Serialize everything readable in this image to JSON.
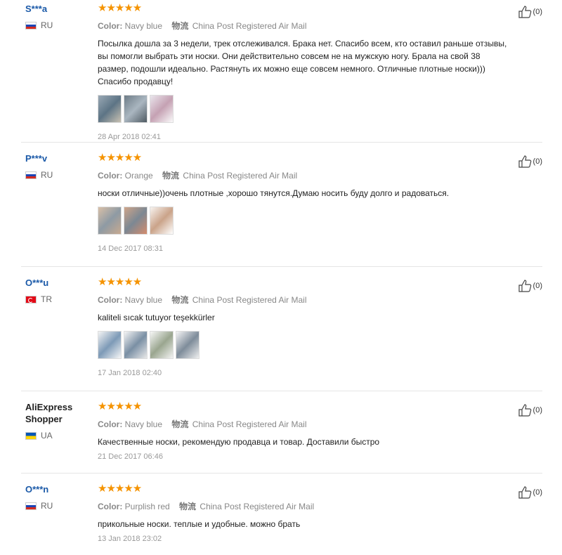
{
  "reviews": [
    {
      "user": "S***a",
      "country": "RU",
      "flag": "ru",
      "stars": "★★★★★",
      "color_label": "Color:",
      "color": "Navy blue",
      "ship_label": "物流",
      "shipping": "China Post Registered Air Mail",
      "text": "Посылка дошла за 3 недели, трек отслеживался. Брака нет. Спасибо всем, кто оставил раньше отзывы, вы помогли выбрать эти носки. Они действительно совсем не на мужскую ногу. Брала на свой 38 размер, подошли идеально. Растянуть их можно еще совсем немного. Отличные плотные носки))) Спасибо продавцу!",
      "date": "28 Apr 2018 02:41",
      "likes": "(0)"
    },
    {
      "user": "P***v",
      "country": "RU",
      "flag": "ru",
      "stars": "★★★★★",
      "color_label": "Color:",
      "color": "Orange",
      "ship_label": "物流",
      "shipping": "China Post Registered Air Mail",
      "text": "носки отличные))очень плотные ,хорошо тянутся.Думаю носить буду долго и радоваться.",
      "date": "14 Dec 2017 08:31",
      "likes": "(0)"
    },
    {
      "user": "O***u",
      "country": "TR",
      "flag": "tr",
      "stars": "★★★★★",
      "color_label": "Color:",
      "color": "Navy blue",
      "ship_label": "物流",
      "shipping": "China Post Registered Air Mail",
      "text": "kaliteli sıcak tutuyor teşekkürler",
      "date": "17 Jan 2018 02:40",
      "likes": "(0)"
    },
    {
      "user": "AliExpress Shopper",
      "country": "UA",
      "flag": "ua",
      "stars": "★★★★★",
      "color_label": "Color:",
      "color": "Navy blue",
      "ship_label": "物流",
      "shipping": "China Post Registered Air Mail",
      "text": "Качественные носки, рекомендую продавца и товар. Доставили быстро",
      "date": "21 Dec 2017 06:46",
      "likes": "(0)"
    },
    {
      "user": "O***n",
      "country": "RU",
      "flag": "ru",
      "stars": "★★★★★",
      "color_label": "Color:",
      "color": "Purplish red",
      "ship_label": "物流",
      "shipping": "China Post Registered Air Mail",
      "text": "прикольные носки. теплые и удобные. можно брать",
      "date": "13 Jan 2018 23:02",
      "likes": "(0)"
    }
  ],
  "colors": {
    "star": "#f59300",
    "username": "#1a59a8",
    "meta": "#888888"
  }
}
